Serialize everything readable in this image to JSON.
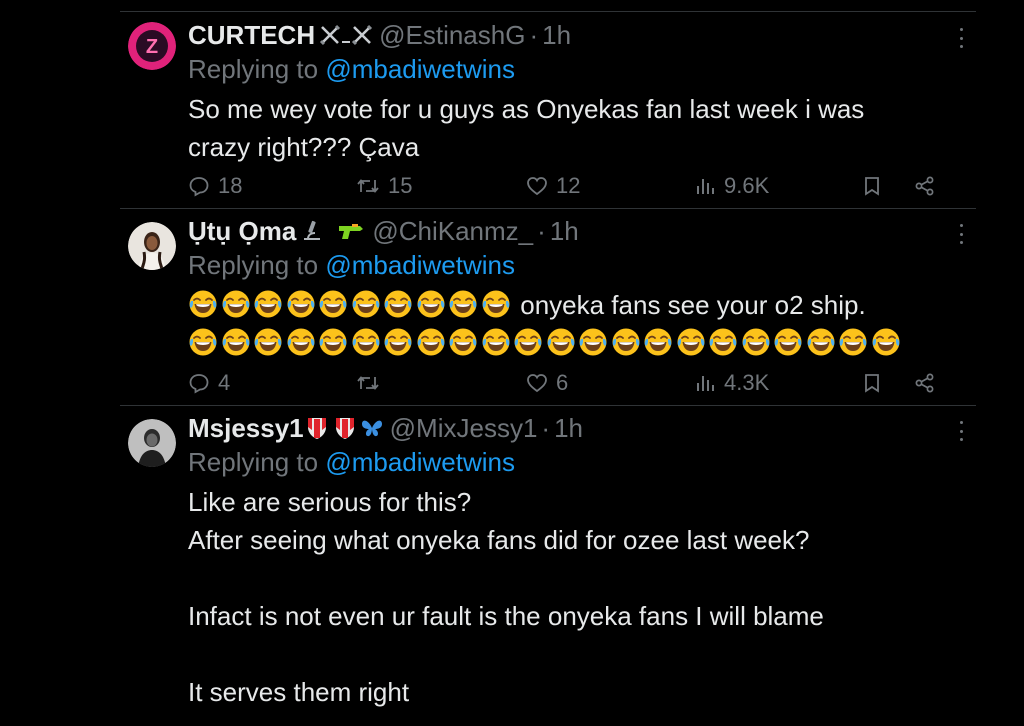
{
  "tweets": [
    {
      "name": "CURTECH",
      "handle": "@EstinashG",
      "dot": "·",
      "time": "1h",
      "replying_prefix": "Replying to ",
      "replying_to": "@mbadiwetwins",
      "text_lines": [
        "So me wey vote for u guys as Onyekas fan last week i was",
        "crazy right??? Çava"
      ],
      "replies": "18",
      "retweets": "15",
      "likes": "12",
      "views": "9.6K"
    },
    {
      "name": "Ụtụ Ọma",
      "handle": "@ChiKanmz_",
      "dot": "·",
      "time": "1h",
      "replying_prefix": "Replying to ",
      "replying_to": "@mbadiwetwins",
      "text_line1_suffix": "onyeka fans see your o2 ship.",
      "emoji_line1_count": 10,
      "emoji_line2_count": 22,
      "emoji_name": "face-with-tears-of-joy",
      "replies": "4",
      "retweets": "",
      "likes": "6",
      "views": "4.3K"
    },
    {
      "name": "Msjessy1",
      "handle": "@MixJessy1",
      "dot": "·",
      "time": "1h",
      "replying_prefix": "Replying to ",
      "replying_to": "@mbadiwetwins",
      "text_lines": [
        "Like are serious for this?",
        "After seeing what onyeka fans did for ozee last week?",
        "",
        "Infact is not even ur fault is the onyeka fans I will blame",
        "",
        "It serves them right"
      ]
    }
  ],
  "colors": {
    "background": "#000000",
    "text": "#e7e9ea",
    "secondary": "#71767b",
    "link": "#1d9bf0",
    "divider": "#2f3336"
  }
}
